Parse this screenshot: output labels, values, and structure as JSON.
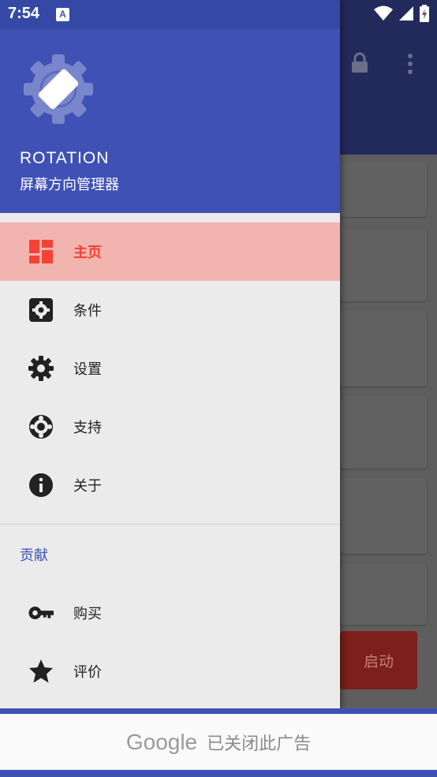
{
  "status_bar": {
    "time": "7:54",
    "notification_badge": "A"
  },
  "drawer": {
    "header": {
      "title": "ROTATION",
      "subtitle": "屏幕方向管理器"
    },
    "items": [
      {
        "label": "主页",
        "icon": "dashboard-icon",
        "active": true
      },
      {
        "label": "条件",
        "icon": "settings-box-icon",
        "active": false
      },
      {
        "label": "设置",
        "icon": "gear-icon",
        "active": false
      },
      {
        "label": "支持",
        "icon": "lifebuoy-icon",
        "active": false
      },
      {
        "label": "关于",
        "icon": "info-icon",
        "active": false
      }
    ],
    "section": "贡献",
    "items2": [
      {
        "label": "购买",
        "icon": "key-icon"
      },
      {
        "label": "评价",
        "icon": "star-icon"
      }
    ]
  },
  "background": {
    "start_button": "启动"
  },
  "ad": {
    "brand": "Google",
    "text": "已关闭此广告"
  },
  "colors": {
    "primary": "#3f51b5",
    "accent": "#f44336",
    "active_bg": "#f2b4af"
  }
}
